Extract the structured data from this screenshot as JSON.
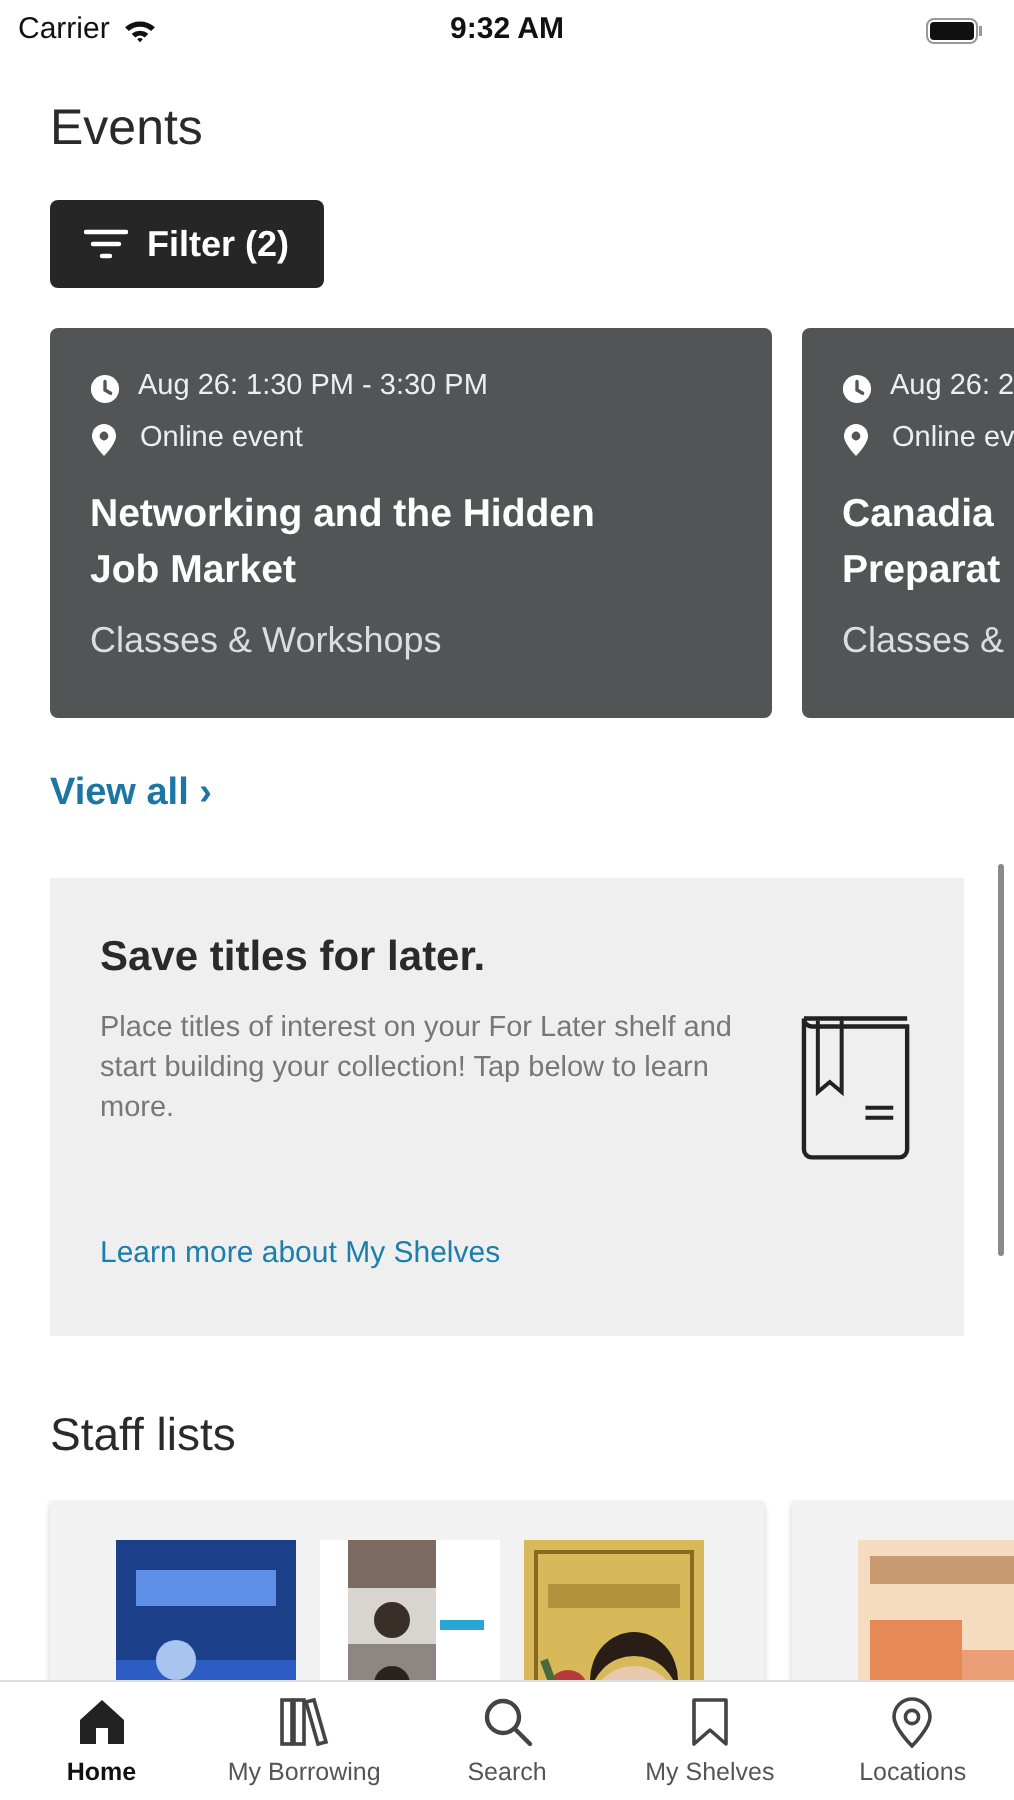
{
  "status_bar": {
    "carrier": "Carrier",
    "time": "9:32 AM"
  },
  "events": {
    "title": "Events",
    "filter_button": "Filter (2)",
    "cards": [
      {
        "time": "Aug 26: 1:30 PM - 3:30 PM",
        "location": "Online event",
        "title": "Networking and the Hidden Job Market",
        "category": "Classes & Workshops"
      },
      {
        "time": "Aug 26: 2",
        "location": "Online ev",
        "title": "Canadia\nPreparat",
        "category": "Classes &"
      }
    ],
    "view_all": "View all ›"
  },
  "promo": {
    "title": "Save titles for later.",
    "body": "Place titles of interest on your For Later shelf and start building your collection! Tap below to learn more.",
    "link": "Learn more about My Shelves"
  },
  "staff_lists": {
    "title": "Staff lists"
  },
  "tab_bar": [
    {
      "kind": "home",
      "label": "Home",
      "selected": true
    },
    {
      "kind": "borrowing",
      "label": "My Borrowing",
      "selected": false
    },
    {
      "kind": "search",
      "label": "Search",
      "selected": false
    },
    {
      "kind": "shelves",
      "label": "My Shelves",
      "selected": false
    },
    {
      "kind": "locations",
      "label": "Locations",
      "selected": false
    }
  ]
}
